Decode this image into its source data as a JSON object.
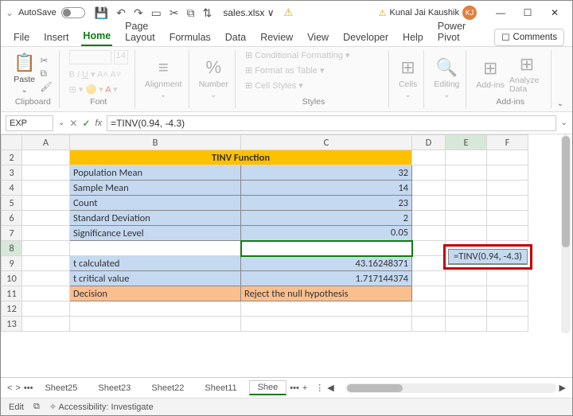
{
  "titlebar": {
    "autosave": "AutoSave",
    "filename": "sales.xlsx ∨",
    "user": "Kunal Jai Kaushik",
    "initials": "KJ"
  },
  "tabs": {
    "file": "File",
    "insert": "Insert",
    "home": "Home",
    "layout": "Page Layout",
    "formulas": "Formulas",
    "data": "Data",
    "review": "Review",
    "view": "View",
    "developer": "Developer",
    "help": "Help",
    "powerpivot": "Power Pivot",
    "comments": "Comments"
  },
  "ribbon": {
    "paste": "Paste",
    "clipboard": "Clipboard",
    "font": "Font",
    "fontsize": "14",
    "alignment": "Alignment",
    "number": "Number",
    "condfmt": "Conditional Formatting",
    "fmttable": "Format as Table",
    "cellstyles": "Cell Styles",
    "styles": "Styles",
    "cells": "Cells",
    "editing": "Editing",
    "addins": "Add-ins",
    "analyze": "Analyze Data",
    "addinslbl": "Add-ins",
    "pct": "%"
  },
  "formulabar": {
    "namebox": "EXP",
    "formula": "=TINV(0.94, -4.3)"
  },
  "cols": {
    "a": "A",
    "b": "B",
    "c": "C",
    "d": "D",
    "e": "E",
    "f": "F"
  },
  "sheet": {
    "title": "TINV Function",
    "r3": {
      "label": "Population Mean",
      "val": "32"
    },
    "r4": {
      "label": "Sample Mean",
      "val": "14"
    },
    "r5": {
      "label": "Count",
      "val": "23"
    },
    "r6": {
      "label": "Standard Deviation",
      "val": "2"
    },
    "r7": {
      "label": "Significance Level",
      "val": "0.05"
    },
    "r9": {
      "label": "t calculated",
      "val": "43.16248371"
    },
    "r10": {
      "label": "t critical value",
      "val": "1.717144374"
    },
    "r11": {
      "label": "Decision",
      "val": "Reject the null hypothesis"
    },
    "e8": "=TINV(0.94, -4.3)"
  },
  "sheettabs": {
    "s25": "Sheet25",
    "s23": "Sheet23",
    "s22": "Sheet22",
    "s11": "Sheet11",
    "active": "Shee"
  },
  "status": {
    "mode": "Edit",
    "acc": "Accessibility: Investigate"
  },
  "rows": {
    "2": "2",
    "3": "3",
    "4": "4",
    "5": "5",
    "6": "6",
    "7": "7",
    "8": "8",
    "9": "9",
    "10": "10",
    "11": "11",
    "12": "12",
    "13": "13"
  }
}
